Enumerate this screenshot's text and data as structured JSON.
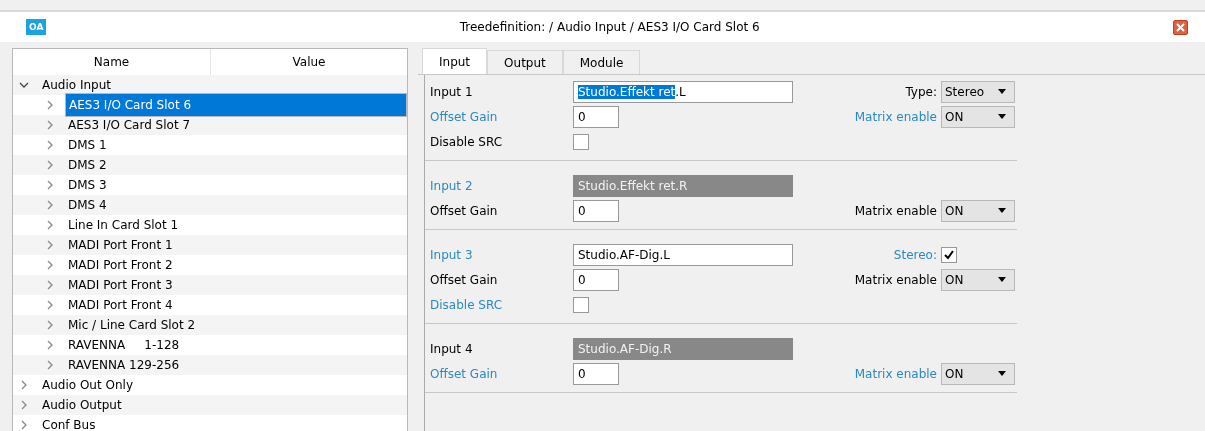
{
  "window": {
    "logo": "OA",
    "title": "Treedefinition:  / Audio Input / AES3 I/O Card Slot 6"
  },
  "tree": {
    "columns": [
      "Name",
      "Value"
    ],
    "items": [
      {
        "label": "Audio Input",
        "expanded": true,
        "selected": false,
        "children": [
          {
            "label": "AES3 I/O Card Slot 6",
            "expanded": false,
            "selected": true
          },
          {
            "label": "AES3 I/O Card Slot 7",
            "expanded": false,
            "selected": false
          },
          {
            "label": "DMS 1",
            "expanded": false,
            "selected": false
          },
          {
            "label": "DMS 2",
            "expanded": false,
            "selected": false
          },
          {
            "label": "DMS 3",
            "expanded": false,
            "selected": false
          },
          {
            "label": "DMS 4",
            "expanded": false,
            "selected": false
          },
          {
            "label": "Line In Card Slot 1",
            "expanded": false,
            "selected": false
          },
          {
            "label": "MADI Port Front 1",
            "expanded": false,
            "selected": false
          },
          {
            "label": "MADI Port Front 2",
            "expanded": false,
            "selected": false
          },
          {
            "label": "MADI Port Front 3",
            "expanded": false,
            "selected": false
          },
          {
            "label": "MADI Port Front 4",
            "expanded": false,
            "selected": false
          },
          {
            "label": "Mic / Line Card Slot 2",
            "expanded": false,
            "selected": false
          },
          {
            "label": "RAVENNA     1-128",
            "expanded": false,
            "selected": false
          },
          {
            "label": "RAVENNA 129-256",
            "expanded": false,
            "selected": false
          }
        ]
      },
      {
        "label": "Audio Out Only",
        "expanded": false,
        "selected": false
      },
      {
        "label": "Audio Output",
        "expanded": false,
        "selected": false
      },
      {
        "label": "Conf Bus",
        "expanded": false,
        "selected": false
      }
    ]
  },
  "tabs": [
    {
      "label": "Input",
      "selected": true
    },
    {
      "label": "Output",
      "selected": false
    },
    {
      "label": "Module",
      "selected": false
    }
  ],
  "sections": [
    {
      "rows": [
        {
          "label": "Input 1",
          "highlighted": false,
          "control": {
            "kind": "name",
            "disabled": false,
            "parts": [
              {
                "text": "Studio.Effekt ret",
                "selected": true
              },
              {
                "text": ".L",
                "selected": false
              }
            ]
          },
          "right": {
            "kind": "select",
            "label": "Type:",
            "highlighted": false,
            "value": "Stereo"
          }
        },
        {
          "label": "Offset Gain",
          "highlighted": true,
          "control": {
            "kind": "number",
            "value": "0"
          },
          "right": {
            "kind": "select",
            "label": "Matrix enable",
            "highlighted": true,
            "value": "ON"
          }
        },
        {
          "label": "Disable SRC",
          "highlighted": false,
          "control": {
            "kind": "checkbox",
            "checked": false
          }
        }
      ]
    },
    {
      "rows": [
        {
          "label": "Input 2",
          "highlighted": true,
          "control": {
            "kind": "name",
            "disabled": true,
            "parts": [
              {
                "text": "Studio.Effekt ret.R",
                "selected": false
              }
            ]
          }
        },
        {
          "label": "Offset Gain",
          "highlighted": false,
          "control": {
            "kind": "number",
            "value": "0"
          },
          "right": {
            "kind": "select",
            "label": "Matrix enable",
            "highlighted": false,
            "value": "ON"
          }
        }
      ]
    },
    {
      "rows": [
        {
          "label": "Input 3",
          "highlighted": true,
          "control": {
            "kind": "name",
            "disabled": false,
            "parts": [
              {
                "text": "Studio.AF-Dig.L",
                "selected": false
              }
            ]
          },
          "right": {
            "kind": "checkbox",
            "label": "Stereo:",
            "highlighted": true,
            "checked": true
          }
        },
        {
          "label": "Offset Gain",
          "highlighted": false,
          "control": {
            "kind": "number",
            "value": "0"
          },
          "right": {
            "kind": "select",
            "label": "Matrix enable",
            "highlighted": false,
            "value": "ON"
          }
        },
        {
          "label": "Disable SRC",
          "highlighted": true,
          "control": {
            "kind": "checkbox",
            "checked": false
          }
        }
      ]
    },
    {
      "rows": [
        {
          "label": "Input 4",
          "highlighted": false,
          "control": {
            "kind": "name",
            "disabled": true,
            "parts": [
              {
                "text": "Studio.AF-Dig.R",
                "selected": false
              }
            ]
          }
        },
        {
          "label": "Offset Gain",
          "highlighted": true,
          "control": {
            "kind": "number",
            "value": "0"
          },
          "right": {
            "kind": "select",
            "label": "Matrix enable",
            "highlighted": true,
            "value": "ON"
          }
        }
      ]
    }
  ]
}
